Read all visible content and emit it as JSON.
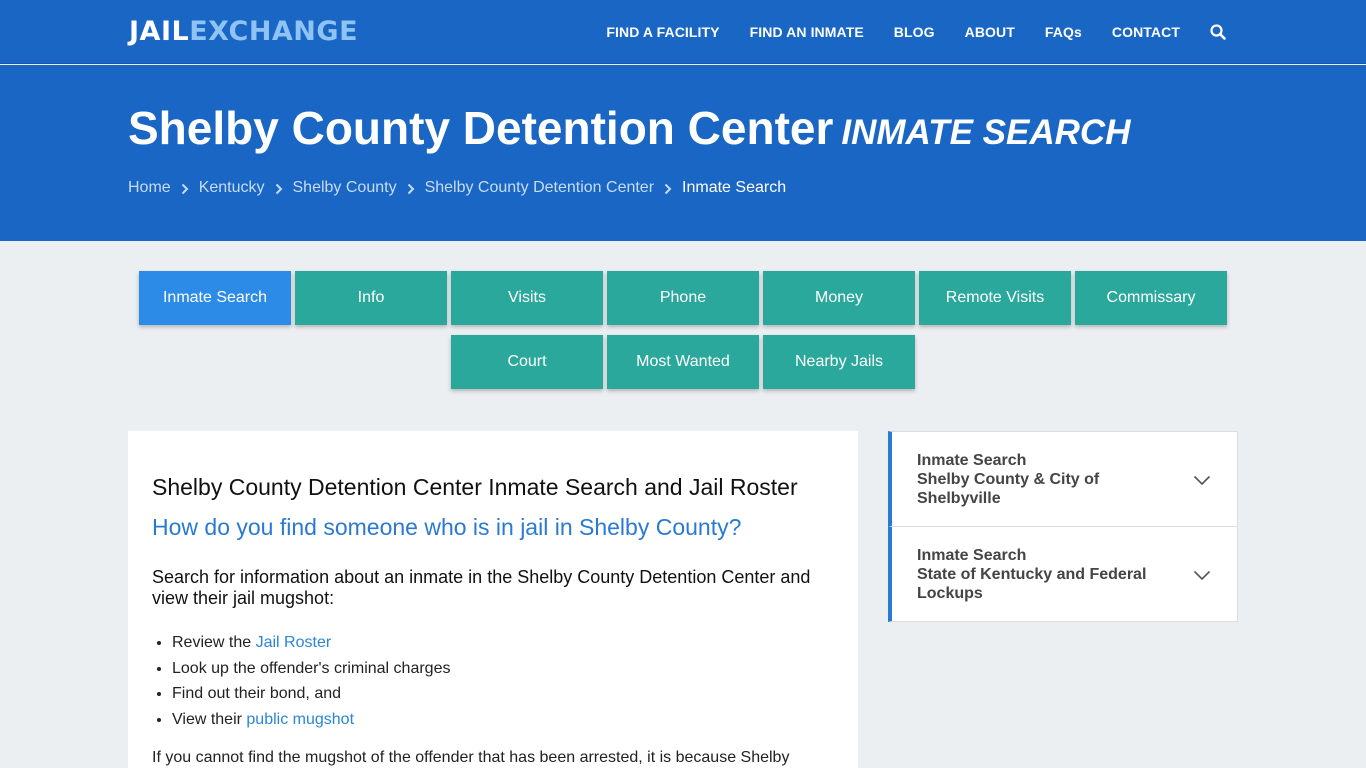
{
  "brand": {
    "part1": "JAIL",
    "part2": "EXCHANGE"
  },
  "nav": [
    "FIND A FACILITY",
    "FIND AN INMATE",
    "BLOG",
    "ABOUT",
    "FAQs",
    "CONTACT"
  ],
  "hero": {
    "title": "Shelby County Detention Center",
    "subtitle": "INMATE SEARCH"
  },
  "breadcrumb": [
    "Home",
    "Kentucky",
    "Shelby County",
    "Shelby County Detention Center",
    "Inmate Search"
  ],
  "tabs": [
    "Inmate Search",
    "Info",
    "Visits",
    "Phone",
    "Money",
    "Remote Visits",
    "Commissary",
    "Court",
    "Most Wanted",
    "Nearby Jails"
  ],
  "content": {
    "heading": "Shelby County Detention Center Inmate Search and Jail Roster",
    "question": "How do you find someone who is in jail in Shelby County?",
    "lead": "Search for information about an inmate in the Shelby County Detention Center and view their jail mugshot:",
    "list": [
      {
        "prefix": "Review the ",
        "link": "Jail Roster"
      },
      {
        "prefix": "Look up the offender's criminal charges",
        "link": ""
      },
      {
        "prefix": "Find out their bond, and",
        "link": ""
      },
      {
        "prefix": "View their ",
        "link": "public mugshot"
      }
    ],
    "paragraph": "If you cannot find the mugshot of the offender that has been arrested, it is because Shelby"
  },
  "sidebar": [
    {
      "line1": "Inmate Search",
      "line2": "Shelby County & City of Shelbyville"
    },
    {
      "line1": "Inmate Search",
      "line2": "State of Kentucky and Federal Lockups"
    }
  ],
  "colors": {
    "header_blue": "#1a66c4",
    "teal_tab": "#2ba89c",
    "active_tab": "#2b8be6",
    "link": "#2a86d6"
  }
}
